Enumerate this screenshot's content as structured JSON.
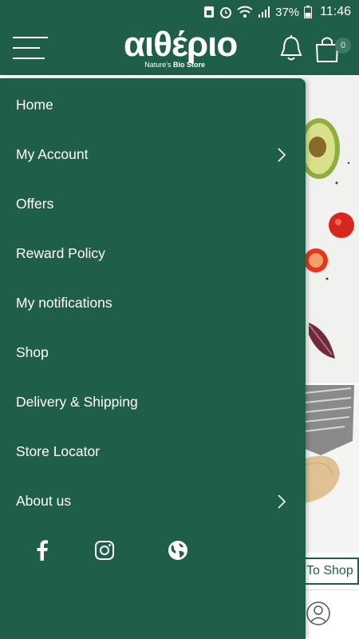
{
  "status_bar": {
    "battery_percent": "37%",
    "time": "11:46",
    "icons": [
      "sim-icon",
      "alarm-icon",
      "wifi-icon",
      "signal-icon",
      "battery-icon"
    ]
  },
  "header": {
    "logo_title": "αιθέριο",
    "logo_tagline_prefix": "Nature's ",
    "logo_tagline_bold": "Bio Store",
    "cart_count": "0"
  },
  "menu": {
    "items": [
      {
        "label": "Home",
        "has_chevron": false
      },
      {
        "label": "My Account",
        "has_chevron": true
      },
      {
        "label": "Offers",
        "has_chevron": false
      },
      {
        "label": "Reward Policy",
        "has_chevron": false
      },
      {
        "label": "My notifications",
        "has_chevron": false
      },
      {
        "label": "Shop",
        "has_chevron": false
      },
      {
        "label": "Delivery & Shipping",
        "has_chevron": false
      },
      {
        "label": "Store Locator",
        "has_chevron": false
      },
      {
        "label": "About us",
        "has_chevron": true
      }
    ],
    "social": [
      "facebook-icon",
      "instagram-icon",
      "globe-icon"
    ]
  },
  "background": {
    "shop_button_label": "To Shop"
  },
  "colors": {
    "brand_green": "#1f5f49",
    "text_white": "#ffffff"
  }
}
